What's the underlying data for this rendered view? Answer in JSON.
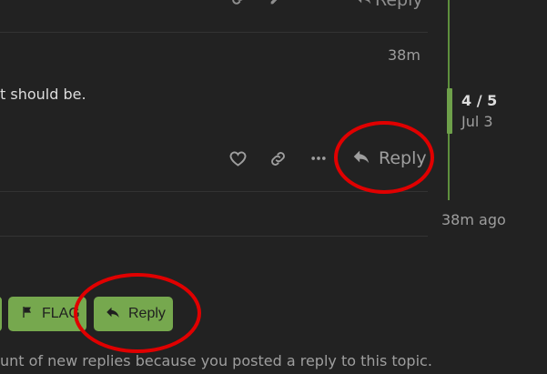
{
  "post": {
    "timestamp": "38m",
    "text": "t should be.",
    "top_reply_label": "Reply",
    "reply_label": "Reply"
  },
  "timeline": {
    "position": "4 / 5",
    "date": "Jul 3",
    "last_activity": "38m ago"
  },
  "footer_buttons": {
    "flag_label": "FLAG",
    "reply_label": "Reply"
  },
  "notification_text": "unt of new replies because you posted a reply to this topic.",
  "colors": {
    "background": "#222222",
    "accent_green": "#76a84e",
    "annotation_red": "#e00000",
    "muted_text": "#9e9e9e"
  },
  "icons": [
    "link-icon",
    "pencil-icon",
    "more-icon",
    "reply-icon",
    "heart-icon",
    "flag-icon"
  ]
}
